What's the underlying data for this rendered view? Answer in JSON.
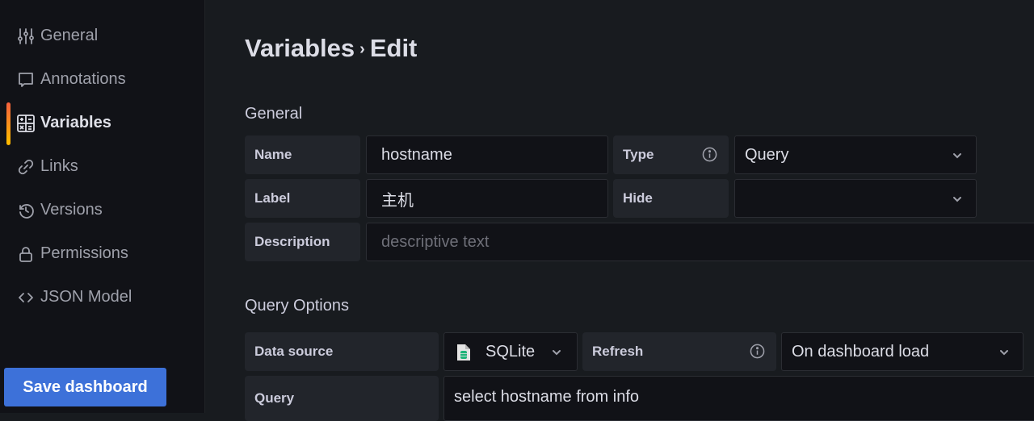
{
  "sidebar": {
    "items": [
      {
        "label": "General",
        "icon": "sliders-icon",
        "active": false
      },
      {
        "label": "Annotations",
        "icon": "comment-icon",
        "active": false
      },
      {
        "label": "Variables",
        "icon": "calculator-icon",
        "active": true
      },
      {
        "label": "Links",
        "icon": "link-icon",
        "active": false
      },
      {
        "label": "Versions",
        "icon": "history-icon",
        "active": false
      },
      {
        "label": "Permissions",
        "icon": "lock-icon",
        "active": false
      },
      {
        "label": "JSON Model",
        "icon": "code-brackets-icon",
        "active": false
      }
    ],
    "save_button": "Save dashboard"
  },
  "header": {
    "breadcrumb_parent": "Variables",
    "separator": "›",
    "breadcrumb_current": "Edit"
  },
  "general": {
    "title": "General",
    "name_label": "Name",
    "name_value": "hostname",
    "type_label": "Type",
    "type_value": "Query",
    "label_label": "Label",
    "label_value": "主机",
    "hide_label": "Hide",
    "hide_value": "",
    "description_label": "Description",
    "description_placeholder": "descriptive text"
  },
  "query_options": {
    "title": "Query Options",
    "data_source_label": "Data source",
    "data_source_value": "SQLite",
    "refresh_label": "Refresh",
    "refresh_value": "On dashboard load",
    "query_label": "Query",
    "query_value": "select hostname from info"
  },
  "colors": {
    "accent_blue": "#3d71d9",
    "active_gradient_start": "#f55f3e",
    "active_gradient_end": "#ffb700",
    "sqlite_green": "#1fb37a"
  }
}
